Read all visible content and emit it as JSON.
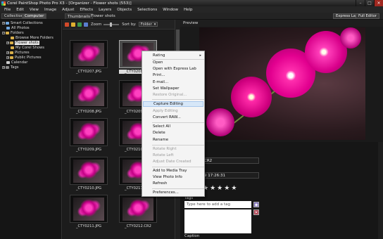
{
  "app": {
    "title": "Corel PaintShop Photo Pro X3 - [Organizer - Flower shots (553)]",
    "window_buttons": [
      "–",
      "□",
      "×"
    ]
  },
  "menubar": [
    "File",
    "Edit",
    "View",
    "Image",
    "Adjust",
    "Effects",
    "Layers",
    "Objects",
    "Selections",
    "Window",
    "Help"
  ],
  "left_tabs": {
    "collections": "Collections",
    "computer": "Computer"
  },
  "workspace_tabs": {
    "thumbnails": "Thumbnails",
    "flower_shots": "Flower shots"
  },
  "workspace_buttons": {
    "express_lab": "Express Lab",
    "full_editor": "Full Editor"
  },
  "tree": {
    "smart_collections": "Smart Collections",
    "all_photos": "All Photos",
    "folders": "Folders",
    "browse_more": "Browse More Folders",
    "flower_shots": "Flower shots",
    "my_corel_shows": "My Corel Shows",
    "pictures": "Pictures",
    "public_pictures": "Public Pictures",
    "calendar": "Calendar",
    "tags": "Tags"
  },
  "toolbar": {
    "zoom_label": "Zoom",
    "sort_label": "Sort by:",
    "sort_value": "Folder"
  },
  "thumbnails": [
    "_CTY0207.JPG",
    "_CTY0208.CR2",
    "_CTY0208.JPG",
    "_CTY0209.CR2",
    "_CTY0209.JPG",
    "_CTY0210.CR2",
    "_CTY0210.JPG",
    "_CTY0211.CR2",
    "_CTY0211.JPG",
    "_CTY0212.CR2"
  ],
  "preview": {
    "label": "Preview"
  },
  "context_menu": {
    "items": [
      {
        "label": "Rating",
        "submenu": true
      },
      {
        "label": "Open"
      },
      {
        "label": "Open with Express Lab"
      },
      {
        "label": "Print..."
      },
      {
        "label": "E-mail..."
      },
      {
        "label": "Set Wallpaper"
      },
      {
        "label": "Restore Original...",
        "disabled": true
      },
      {
        "label": "Capture Editing",
        "hover": true
      },
      {
        "label": "Apply Editing",
        "disabled": true
      },
      {
        "label": "Convert RAW..."
      },
      {
        "label": "Select All"
      },
      {
        "label": "Delete"
      },
      {
        "label": "Rename"
      },
      {
        "label": "Rotate Right",
        "disabled": true
      },
      {
        "label": "Rotate Left",
        "disabled": true
      },
      {
        "label": "Adjust Date Created",
        "disabled": true
      },
      {
        "label": "Add to Media Tray"
      },
      {
        "label": "View Photo Info"
      },
      {
        "label": "Refresh"
      },
      {
        "label": "Preferences..."
      }
    ],
    "submenu_arrow": "▸"
  },
  "info": {
    "filename_partial": "CR2",
    "datetime_partial": "9 17:26:31",
    "rating": 5,
    "star_char": "★",
    "tags_label": "Tags",
    "tag_placeholder": "Type here to add a tag",
    "caption_label": "Caption",
    "add_tag_glyph": "◉",
    "remove_tag_glyph": "✕"
  }
}
